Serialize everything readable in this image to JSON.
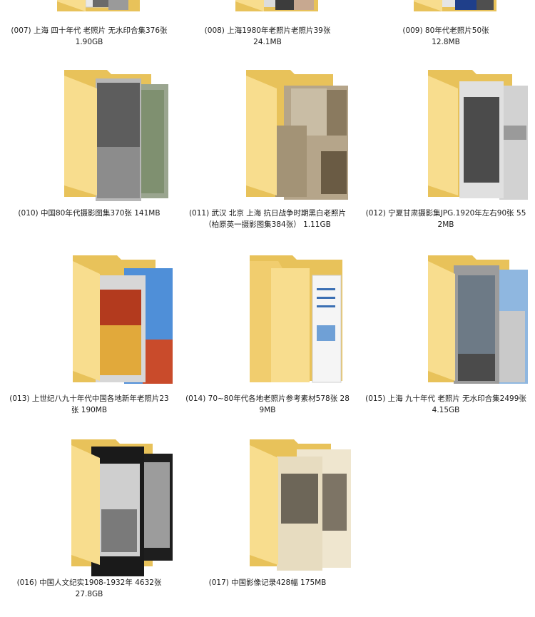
{
  "folders": [
    {
      "name": "(007) 上海 四十年代 老照片 无水印合集376张",
      "size": "1.90GB",
      "thumb": "bw-photos"
    },
    {
      "name": "(008) 上海1980年老照片老照片39张",
      "size": "24.1MB",
      "thumb": "mixed-photos"
    },
    {
      "name": "(009) 80年代老照片50张",
      "size": "12.8MB",
      "thumb": "color-portraits"
    },
    {
      "name": "(010) 中国80年代摄影图集370张",
      "size": "141MB",
      "thumb": "street-crowd"
    },
    {
      "name": "(011) 武汉 北京 上海 抗日战争时期黑白老照片（柏原英一摄影图集384张）",
      "size": "1.11GB",
      "thumb": "sepia-prints"
    },
    {
      "name": "(012) 宁夏甘肃摄影集JPG.1920年左右90张",
      "size": "552MB",
      "thumb": "opera-portrait"
    },
    {
      "name": "(013) 上世纪八九十年代中国各地新年老照片23张",
      "size": "190MB",
      "thumb": "festival-color"
    },
    {
      "name": "(014) 70~80年代各地老照片参考素材578张",
      "size": "289MB",
      "thumb": "documents"
    },
    {
      "name": "(015) 上海 九十年代 老照片 无水印合集2499张",
      "size": "4.15GB",
      "thumb": "buildings"
    },
    {
      "name": "(016) 中国人文纪实1908-1932年 4632张",
      "size": "27.8GB",
      "thumb": "arch-bw"
    },
    {
      "name": "(017) 中国影像记录428幅",
      "size": "175MB",
      "thumb": "engravings"
    }
  ],
  "colors": {
    "folder_back": "#e8c25a",
    "folder_front": "#f8dd8e",
    "folder_edge": "#d9b048",
    "caption_text": "#1a1a1a"
  }
}
